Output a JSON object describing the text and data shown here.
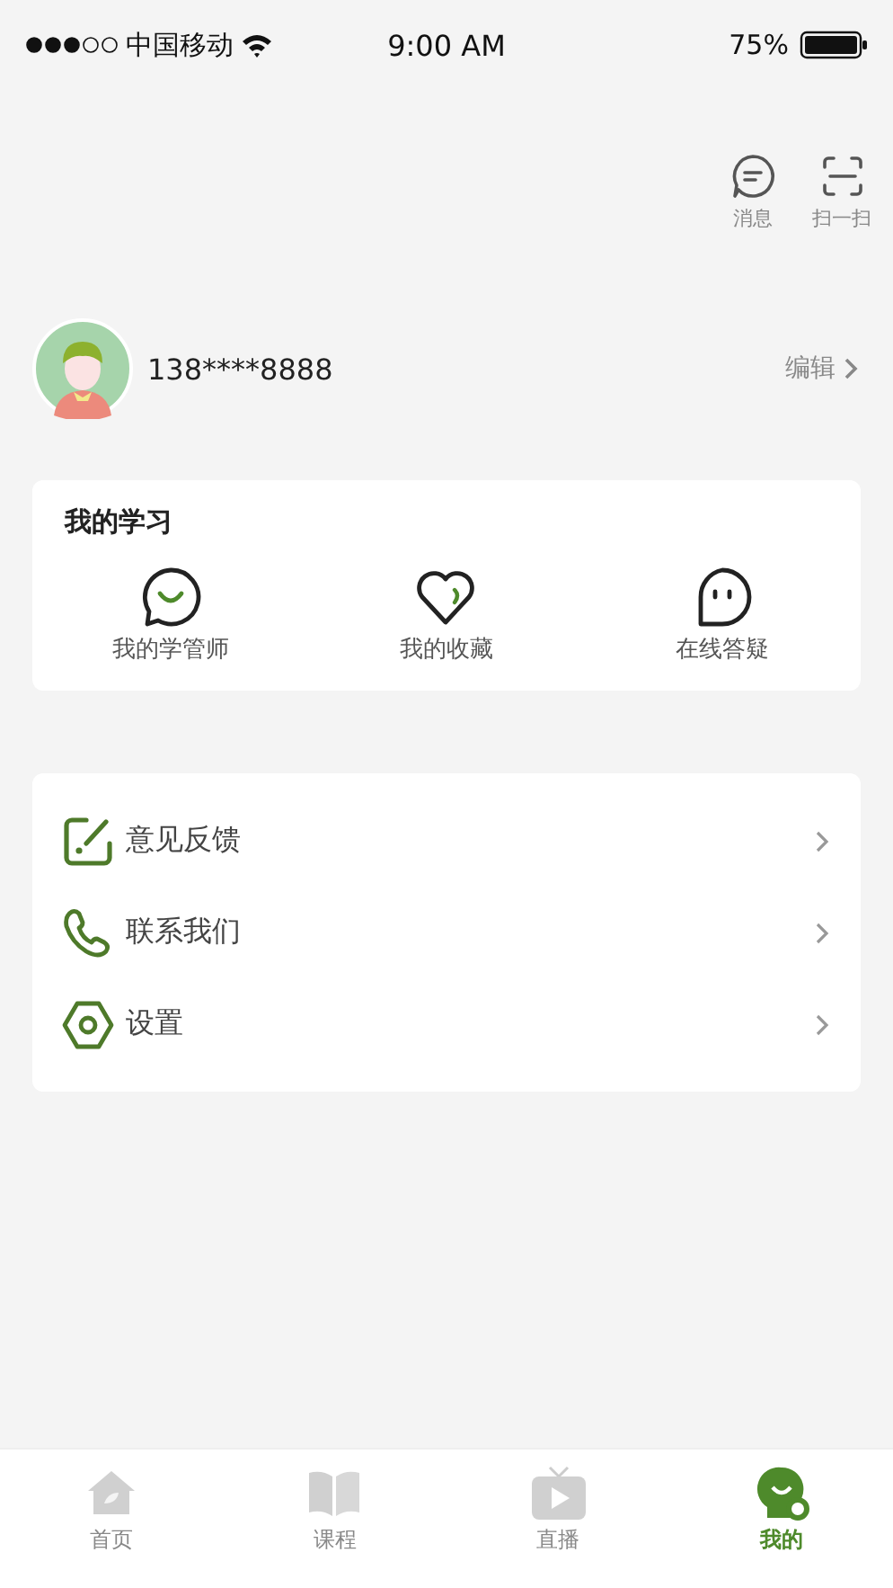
{
  "status_bar": {
    "carrier": "中国移动",
    "time": "9:00 AM",
    "battery": "75%"
  },
  "header_actions": [
    {
      "kind": "message",
      "label": "消息"
    },
    {
      "kind": "scan",
      "label": "扫一扫"
    }
  ],
  "profile": {
    "phone": "138****8888",
    "edit": "编辑"
  },
  "my_learning": {
    "title": "我的学习",
    "items": [
      {
        "kind": "advisor",
        "label": "我的学管师"
      },
      {
        "kind": "favorites",
        "label": "我的收藏"
      },
      {
        "kind": "qa",
        "label": "在线答疑"
      }
    ]
  },
  "menu": [
    {
      "kind": "feedback",
      "label": "意见反馈"
    },
    {
      "kind": "contact",
      "label": "联系我们"
    },
    {
      "kind": "settings",
      "label": "设置"
    }
  ],
  "tabs": [
    {
      "kind": "home",
      "label": "首页",
      "selected": false
    },
    {
      "kind": "course",
      "label": "课程",
      "selected": false
    },
    {
      "kind": "live",
      "label": "直播",
      "selected": false
    },
    {
      "kind": "mine",
      "label": "我的",
      "selected": true
    }
  ]
}
